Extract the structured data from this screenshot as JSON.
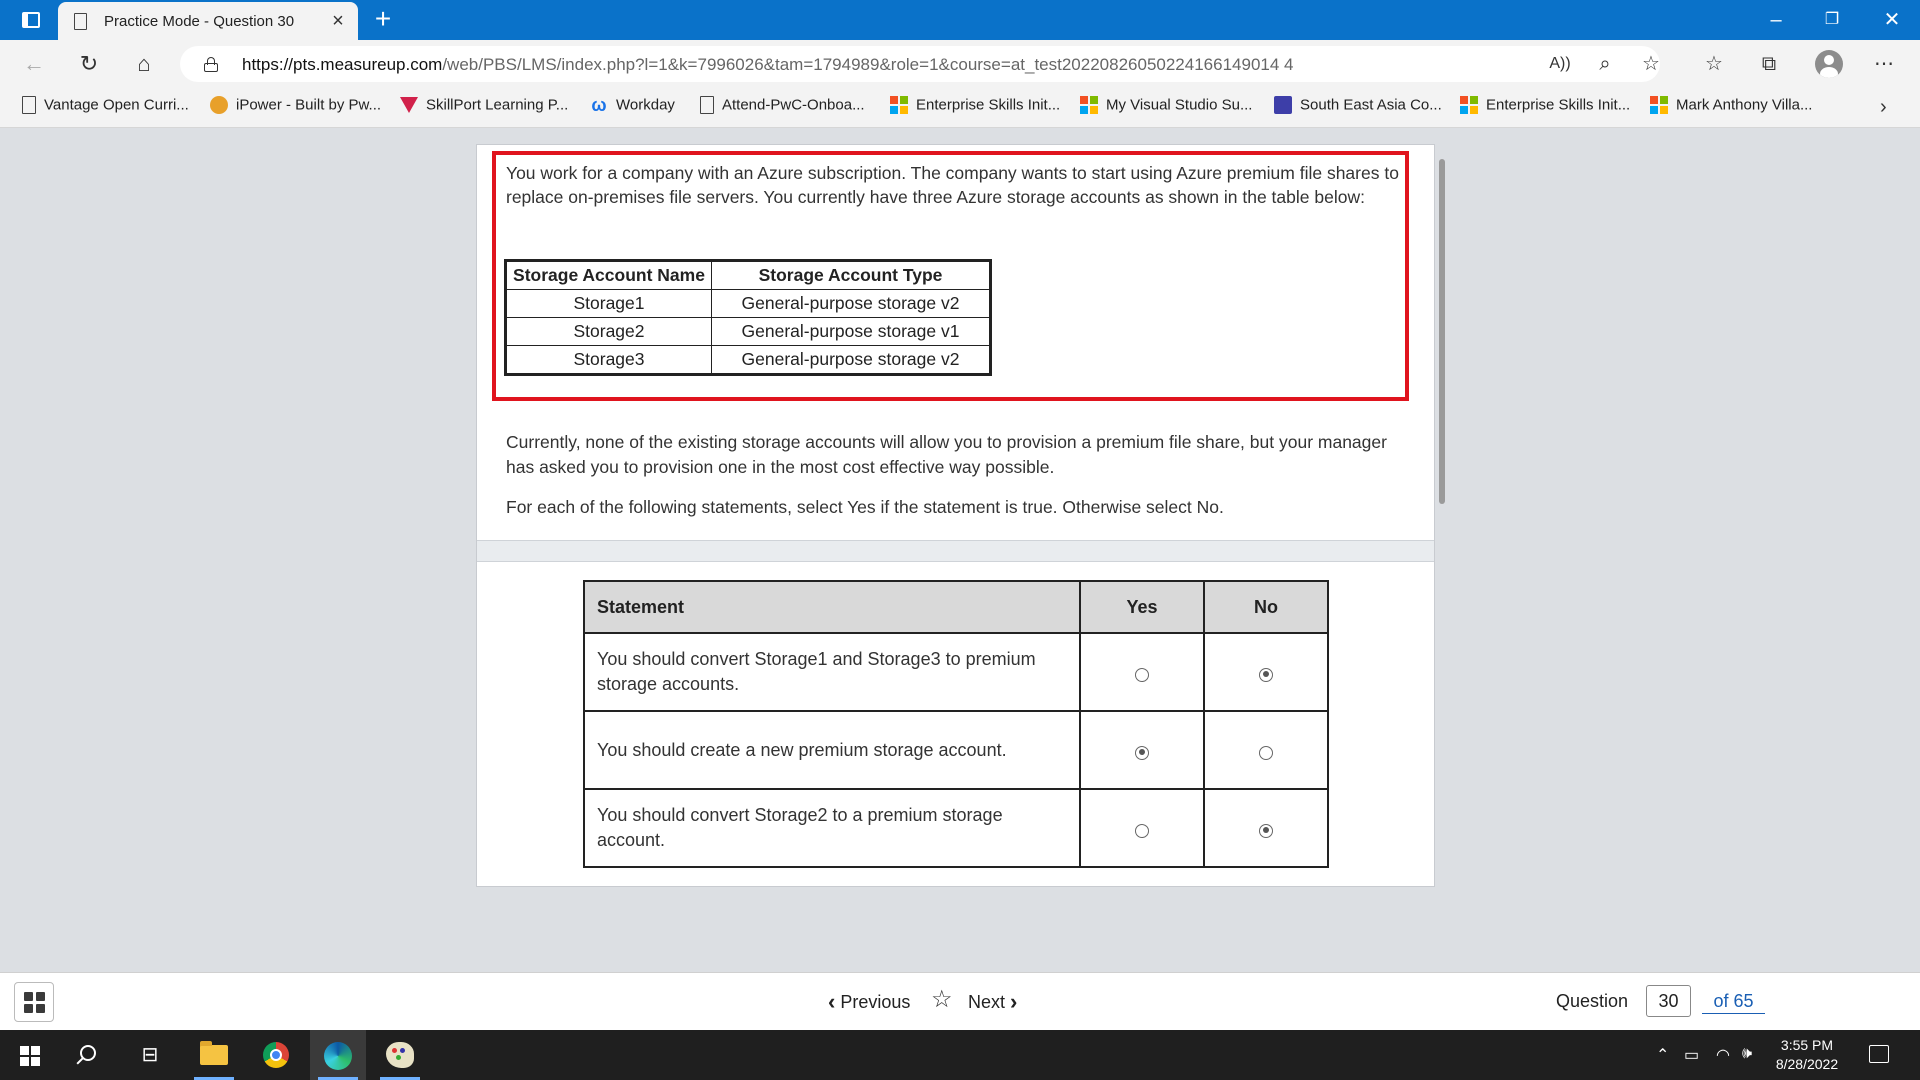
{
  "browser": {
    "tab_title": "Practice Mode - Question 30",
    "url_host": "https://pts.measureup.com",
    "url_path": "/web/PBS/LMS/index.php?l=1&k=7996026&tam=1794989&role=1&course=at_test20220826050224166149014 4",
    "bookmarks": [
      {
        "label": "Vantage Open Curri...",
        "icon": "page-icon"
      },
      {
        "label": "iPower - Built by Pw...",
        "icon": "ipower-icon"
      },
      {
        "label": "SkillPort Learning P...",
        "icon": "skillport-icon"
      },
      {
        "label": "Workday",
        "icon": "workday-icon"
      },
      {
        "label": "Attend-PwC-Onboa...",
        "icon": "page-icon"
      },
      {
        "label": "Enterprise Skills Init...",
        "icon": "microsoft-icon"
      },
      {
        "label": "My Visual Studio Su...",
        "icon": "microsoft-icon"
      },
      {
        "label": "South East Asia Co...",
        "icon": "calendar-icon"
      },
      {
        "label": "Enterprise Skills Init...",
        "icon": "microsoft-icon"
      },
      {
        "label": "Mark Anthony Villa...",
        "icon": "microsoft-icon"
      }
    ]
  },
  "question": {
    "intro": "You work for a company with an Azure subscription. The company wants to start using Azure premium file shares to replace on-premises file servers. You currently have three Azure storage accounts as shown in the table below:",
    "table": {
      "headers": [
        "Storage Account Name",
        "Storage Account Type"
      ],
      "rows": [
        [
          "Storage1",
          "General-purpose storage v2"
        ],
        [
          "Storage2",
          "General-purpose storage v1"
        ],
        [
          "Storage3",
          "General-purpose storage v2"
        ]
      ]
    },
    "para2": "Currently, none of the existing storage accounts will allow you to provision a premium file share, but your manager has asked you to provision one in the most cost effective way possible.",
    "para3": "For each of the following statements, select Yes if the statement is true. Otherwise select No."
  },
  "answers": {
    "headers": {
      "statement": "Statement",
      "yes": "Yes",
      "no": "No"
    },
    "rows": [
      {
        "statement": "You should convert Storage1 and Storage3 to premium storage accounts.",
        "selected": "No"
      },
      {
        "statement": "You should create a new premium storage account.",
        "selected": "Yes"
      },
      {
        "statement": "You should convert Storage2 to a premium storage account.",
        "selected": "No"
      }
    ]
  },
  "footer": {
    "previous": "Previous",
    "next": "Next",
    "question_label": "Question",
    "question_number": "30",
    "of_total": "of 65"
  },
  "taskbar": {
    "time": "3:55 PM",
    "date": "8/28/2022"
  },
  "colors": {
    "titlebar": "#0a72c9",
    "highlight_border": "#e0141e",
    "link": "#1a5fb4"
  }
}
